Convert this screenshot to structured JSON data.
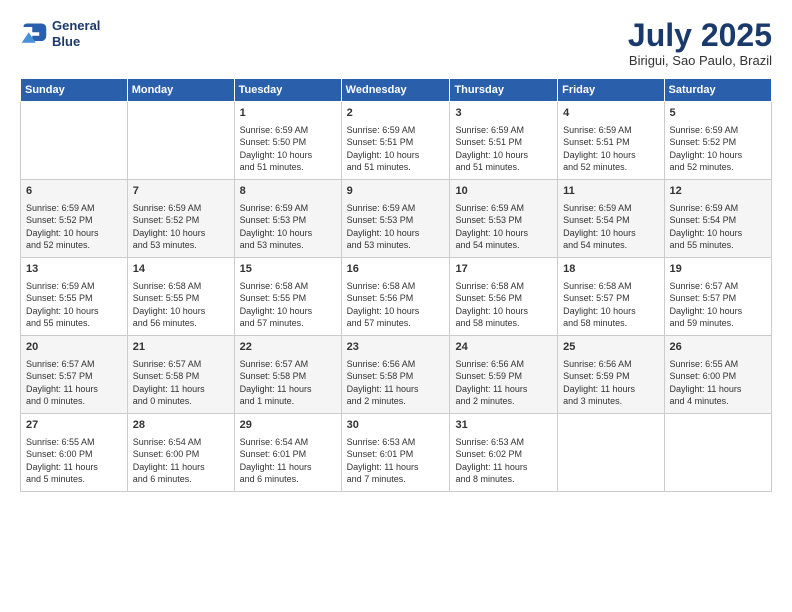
{
  "logo": {
    "line1": "General",
    "line2": "Blue"
  },
  "title": "July 2025",
  "location": "Birigui, Sao Paulo, Brazil",
  "days_of_week": [
    "Sunday",
    "Monday",
    "Tuesday",
    "Wednesday",
    "Thursday",
    "Friday",
    "Saturday"
  ],
  "weeks": [
    [
      {
        "day": "",
        "content": ""
      },
      {
        "day": "",
        "content": ""
      },
      {
        "day": "1",
        "content": "Sunrise: 6:59 AM\nSunset: 5:50 PM\nDaylight: 10 hours\nand 51 minutes."
      },
      {
        "day": "2",
        "content": "Sunrise: 6:59 AM\nSunset: 5:51 PM\nDaylight: 10 hours\nand 51 minutes."
      },
      {
        "day": "3",
        "content": "Sunrise: 6:59 AM\nSunset: 5:51 PM\nDaylight: 10 hours\nand 51 minutes."
      },
      {
        "day": "4",
        "content": "Sunrise: 6:59 AM\nSunset: 5:51 PM\nDaylight: 10 hours\nand 52 minutes."
      },
      {
        "day": "5",
        "content": "Sunrise: 6:59 AM\nSunset: 5:52 PM\nDaylight: 10 hours\nand 52 minutes."
      }
    ],
    [
      {
        "day": "6",
        "content": "Sunrise: 6:59 AM\nSunset: 5:52 PM\nDaylight: 10 hours\nand 52 minutes."
      },
      {
        "day": "7",
        "content": "Sunrise: 6:59 AM\nSunset: 5:52 PM\nDaylight: 10 hours\nand 53 minutes."
      },
      {
        "day": "8",
        "content": "Sunrise: 6:59 AM\nSunset: 5:53 PM\nDaylight: 10 hours\nand 53 minutes."
      },
      {
        "day": "9",
        "content": "Sunrise: 6:59 AM\nSunset: 5:53 PM\nDaylight: 10 hours\nand 53 minutes."
      },
      {
        "day": "10",
        "content": "Sunrise: 6:59 AM\nSunset: 5:53 PM\nDaylight: 10 hours\nand 54 minutes."
      },
      {
        "day": "11",
        "content": "Sunrise: 6:59 AM\nSunset: 5:54 PM\nDaylight: 10 hours\nand 54 minutes."
      },
      {
        "day": "12",
        "content": "Sunrise: 6:59 AM\nSunset: 5:54 PM\nDaylight: 10 hours\nand 55 minutes."
      }
    ],
    [
      {
        "day": "13",
        "content": "Sunrise: 6:59 AM\nSunset: 5:55 PM\nDaylight: 10 hours\nand 55 minutes."
      },
      {
        "day": "14",
        "content": "Sunrise: 6:58 AM\nSunset: 5:55 PM\nDaylight: 10 hours\nand 56 minutes."
      },
      {
        "day": "15",
        "content": "Sunrise: 6:58 AM\nSunset: 5:55 PM\nDaylight: 10 hours\nand 57 minutes."
      },
      {
        "day": "16",
        "content": "Sunrise: 6:58 AM\nSunset: 5:56 PM\nDaylight: 10 hours\nand 57 minutes."
      },
      {
        "day": "17",
        "content": "Sunrise: 6:58 AM\nSunset: 5:56 PM\nDaylight: 10 hours\nand 58 minutes."
      },
      {
        "day": "18",
        "content": "Sunrise: 6:58 AM\nSunset: 5:57 PM\nDaylight: 10 hours\nand 58 minutes."
      },
      {
        "day": "19",
        "content": "Sunrise: 6:57 AM\nSunset: 5:57 PM\nDaylight: 10 hours\nand 59 minutes."
      }
    ],
    [
      {
        "day": "20",
        "content": "Sunrise: 6:57 AM\nSunset: 5:57 PM\nDaylight: 11 hours\nand 0 minutes."
      },
      {
        "day": "21",
        "content": "Sunrise: 6:57 AM\nSunset: 5:58 PM\nDaylight: 11 hours\nand 0 minutes."
      },
      {
        "day": "22",
        "content": "Sunrise: 6:57 AM\nSunset: 5:58 PM\nDaylight: 11 hours\nand 1 minute."
      },
      {
        "day": "23",
        "content": "Sunrise: 6:56 AM\nSunset: 5:58 PM\nDaylight: 11 hours\nand 2 minutes."
      },
      {
        "day": "24",
        "content": "Sunrise: 6:56 AM\nSunset: 5:59 PM\nDaylight: 11 hours\nand 2 minutes."
      },
      {
        "day": "25",
        "content": "Sunrise: 6:56 AM\nSunset: 5:59 PM\nDaylight: 11 hours\nand 3 minutes."
      },
      {
        "day": "26",
        "content": "Sunrise: 6:55 AM\nSunset: 6:00 PM\nDaylight: 11 hours\nand 4 minutes."
      }
    ],
    [
      {
        "day": "27",
        "content": "Sunrise: 6:55 AM\nSunset: 6:00 PM\nDaylight: 11 hours\nand 5 minutes."
      },
      {
        "day": "28",
        "content": "Sunrise: 6:54 AM\nSunset: 6:00 PM\nDaylight: 11 hours\nand 6 minutes."
      },
      {
        "day": "29",
        "content": "Sunrise: 6:54 AM\nSunset: 6:01 PM\nDaylight: 11 hours\nand 6 minutes."
      },
      {
        "day": "30",
        "content": "Sunrise: 6:53 AM\nSunset: 6:01 PM\nDaylight: 11 hours\nand 7 minutes."
      },
      {
        "day": "31",
        "content": "Sunrise: 6:53 AM\nSunset: 6:02 PM\nDaylight: 11 hours\nand 8 minutes."
      },
      {
        "day": "",
        "content": ""
      },
      {
        "day": "",
        "content": ""
      }
    ]
  ]
}
